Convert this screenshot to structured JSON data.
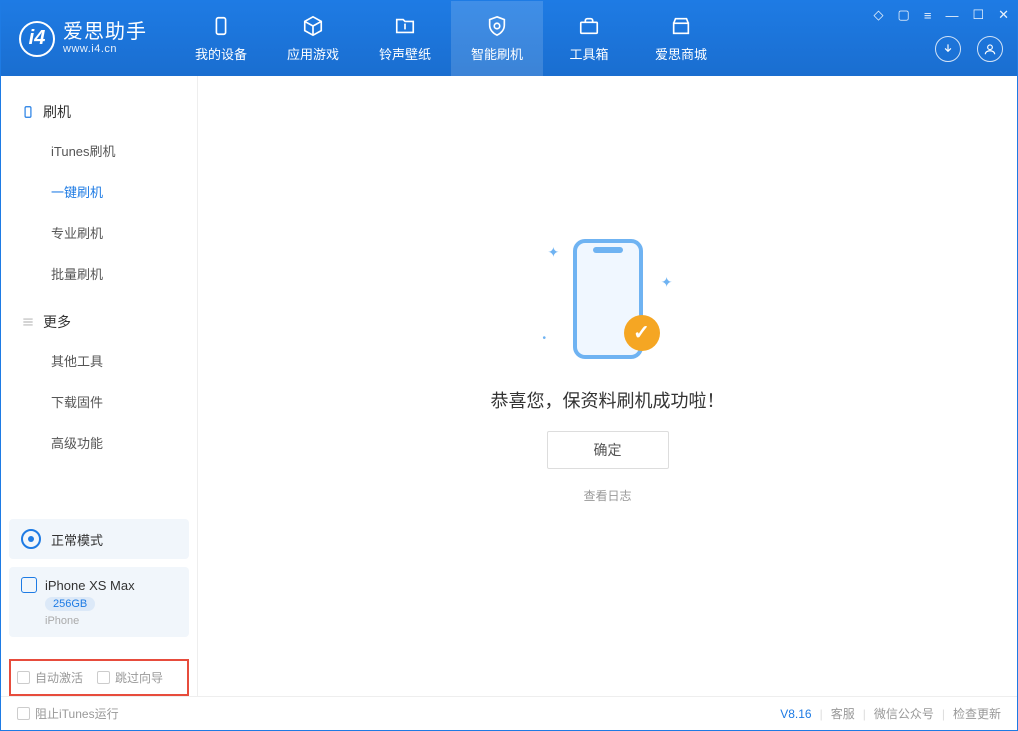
{
  "app": {
    "title": "爱思助手",
    "subtitle": "www.i4.cn"
  },
  "nav": {
    "tabs": [
      {
        "label": "我的设备"
      },
      {
        "label": "应用游戏"
      },
      {
        "label": "铃声壁纸"
      },
      {
        "label": "智能刷机"
      },
      {
        "label": "工具箱"
      },
      {
        "label": "爱思商城"
      }
    ]
  },
  "sidebar": {
    "section1": {
      "title": "刷机",
      "items": [
        "iTunes刷机",
        "一键刷机",
        "专业刷机",
        "批量刷机"
      ]
    },
    "section2": {
      "title": "更多",
      "items": [
        "其他工具",
        "下载固件",
        "高级功能"
      ]
    }
  },
  "mode_card": {
    "label": "正常模式"
  },
  "device": {
    "name": "iPhone XS Max",
    "storage": "256GB",
    "type": "iPhone"
  },
  "options": {
    "auto_activate": "自动激活",
    "skip_guide": "跳过向导"
  },
  "main": {
    "message": "恭喜您，保资料刷机成功啦！",
    "confirm": "确定",
    "log_link": "查看日志"
  },
  "footer": {
    "block_itunes": "阻止iTunes运行",
    "version": "V8.16",
    "links": [
      "客服",
      "微信公众号",
      "检查更新"
    ]
  }
}
